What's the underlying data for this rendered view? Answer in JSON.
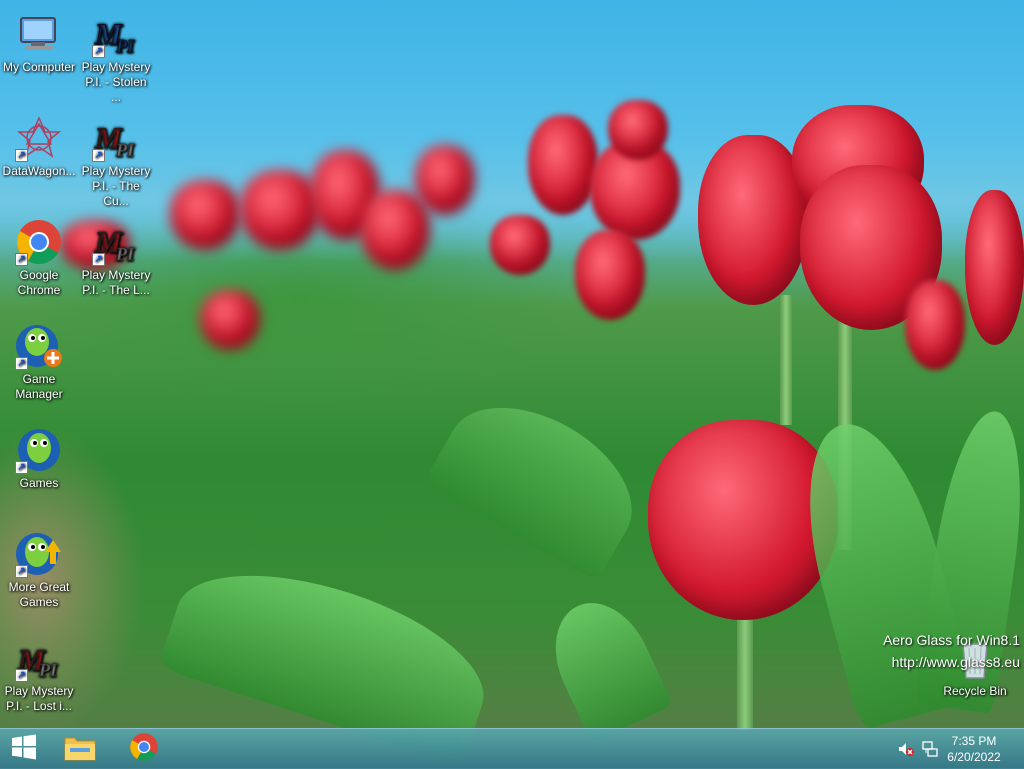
{
  "desktop": {
    "icons": [
      {
        "label": "My Computer",
        "icon": "computer-icon"
      },
      {
        "label": "DataWagon...",
        "icon": "datawagon-icon"
      },
      {
        "label": "Google Chrome",
        "icon": "chrome-icon"
      },
      {
        "label": "Game Manager",
        "icon": "game-manager-icon"
      },
      {
        "label": "Games",
        "icon": "games-icon"
      },
      {
        "label": "More Great Games",
        "icon": "more-games-icon"
      },
      {
        "label": "Play Mystery P.I. - Lost i...",
        "icon": "mystery-pi-icon"
      },
      {
        "label": "Play Mystery P.I. - Stolen ...",
        "icon": "mystery-pi-icon"
      },
      {
        "label": "Play Mystery P.I. - The Cu...",
        "icon": "mystery-pi-icon"
      },
      {
        "label": "Play Mystery P.I. - The L...",
        "icon": "mystery-pi-icon"
      },
      {
        "label": "Recycle Bin",
        "icon": "recycle-bin-icon"
      }
    ]
  },
  "watermark": {
    "line1": "Aero Glass for Win8.1",
    "line2": "http://www.glass8.eu"
  },
  "taskbar": {
    "start_icon": "windows-start-icon",
    "pinned": [
      "file-explorer-icon",
      "chrome-icon"
    ],
    "tray": {
      "icons": [
        "volume-muted-icon",
        "network-icon"
      ],
      "time": "7:35 PM",
      "date": "6/20/2022"
    }
  },
  "colors": {
    "taskbar": "#3f8c9c",
    "chrome_red": "#db4437",
    "chrome_green": "#0f9d58",
    "chrome_yellow": "#f4b400",
    "chrome_blue": "#4285f4"
  }
}
